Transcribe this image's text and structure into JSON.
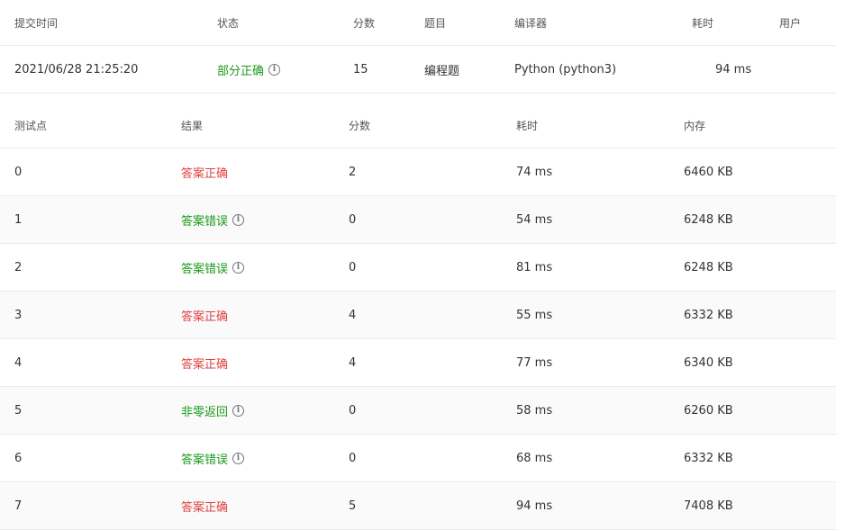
{
  "colors": {
    "accepted": "#e04040",
    "wrong": "#1a9a1a",
    "partial": "#1a9a1a"
  },
  "icons": {
    "info": "info-circle-icon"
  },
  "submission": {
    "headers": {
      "time": "提交时间",
      "status": "状态",
      "score": "分数",
      "problem": "题目",
      "compiler": "编译器",
      "duration": "耗时",
      "user": "用户"
    },
    "row": {
      "time": "2021/06/28 21:25:20",
      "status": "部分正确",
      "score": "15",
      "problem": "编程题",
      "compiler": "Python (python3)",
      "duration": "94 ms",
      "user": ""
    }
  },
  "tests": {
    "headers": {
      "case": "测试点",
      "result": "结果",
      "score": "分数",
      "duration": "耗时",
      "memory": "内存"
    },
    "rows": [
      {
        "case": "0",
        "result": "答案正确",
        "score": "2",
        "duration": "74 ms",
        "memory": "6460 KB"
      },
      {
        "case": "1",
        "result": "答案错误",
        "score": "0",
        "duration": "54 ms",
        "memory": "6248 KB"
      },
      {
        "case": "2",
        "result": "答案错误",
        "score": "0",
        "duration": "81 ms",
        "memory": "6248 KB"
      },
      {
        "case": "3",
        "result": "答案正确",
        "score": "4",
        "duration": "55 ms",
        "memory": "6332 KB"
      },
      {
        "case": "4",
        "result": "答案正确",
        "score": "4",
        "duration": "77 ms",
        "memory": "6340 KB"
      },
      {
        "case": "5",
        "result": "非零返回",
        "score": "0",
        "duration": "58 ms",
        "memory": "6260 KB"
      },
      {
        "case": "6",
        "result": "答案错误",
        "score": "0",
        "duration": "68 ms",
        "memory": "6332 KB"
      },
      {
        "case": "7",
        "result": "答案正确",
        "score": "5",
        "duration": "94 ms",
        "memory": "7408 KB"
      }
    ]
  }
}
